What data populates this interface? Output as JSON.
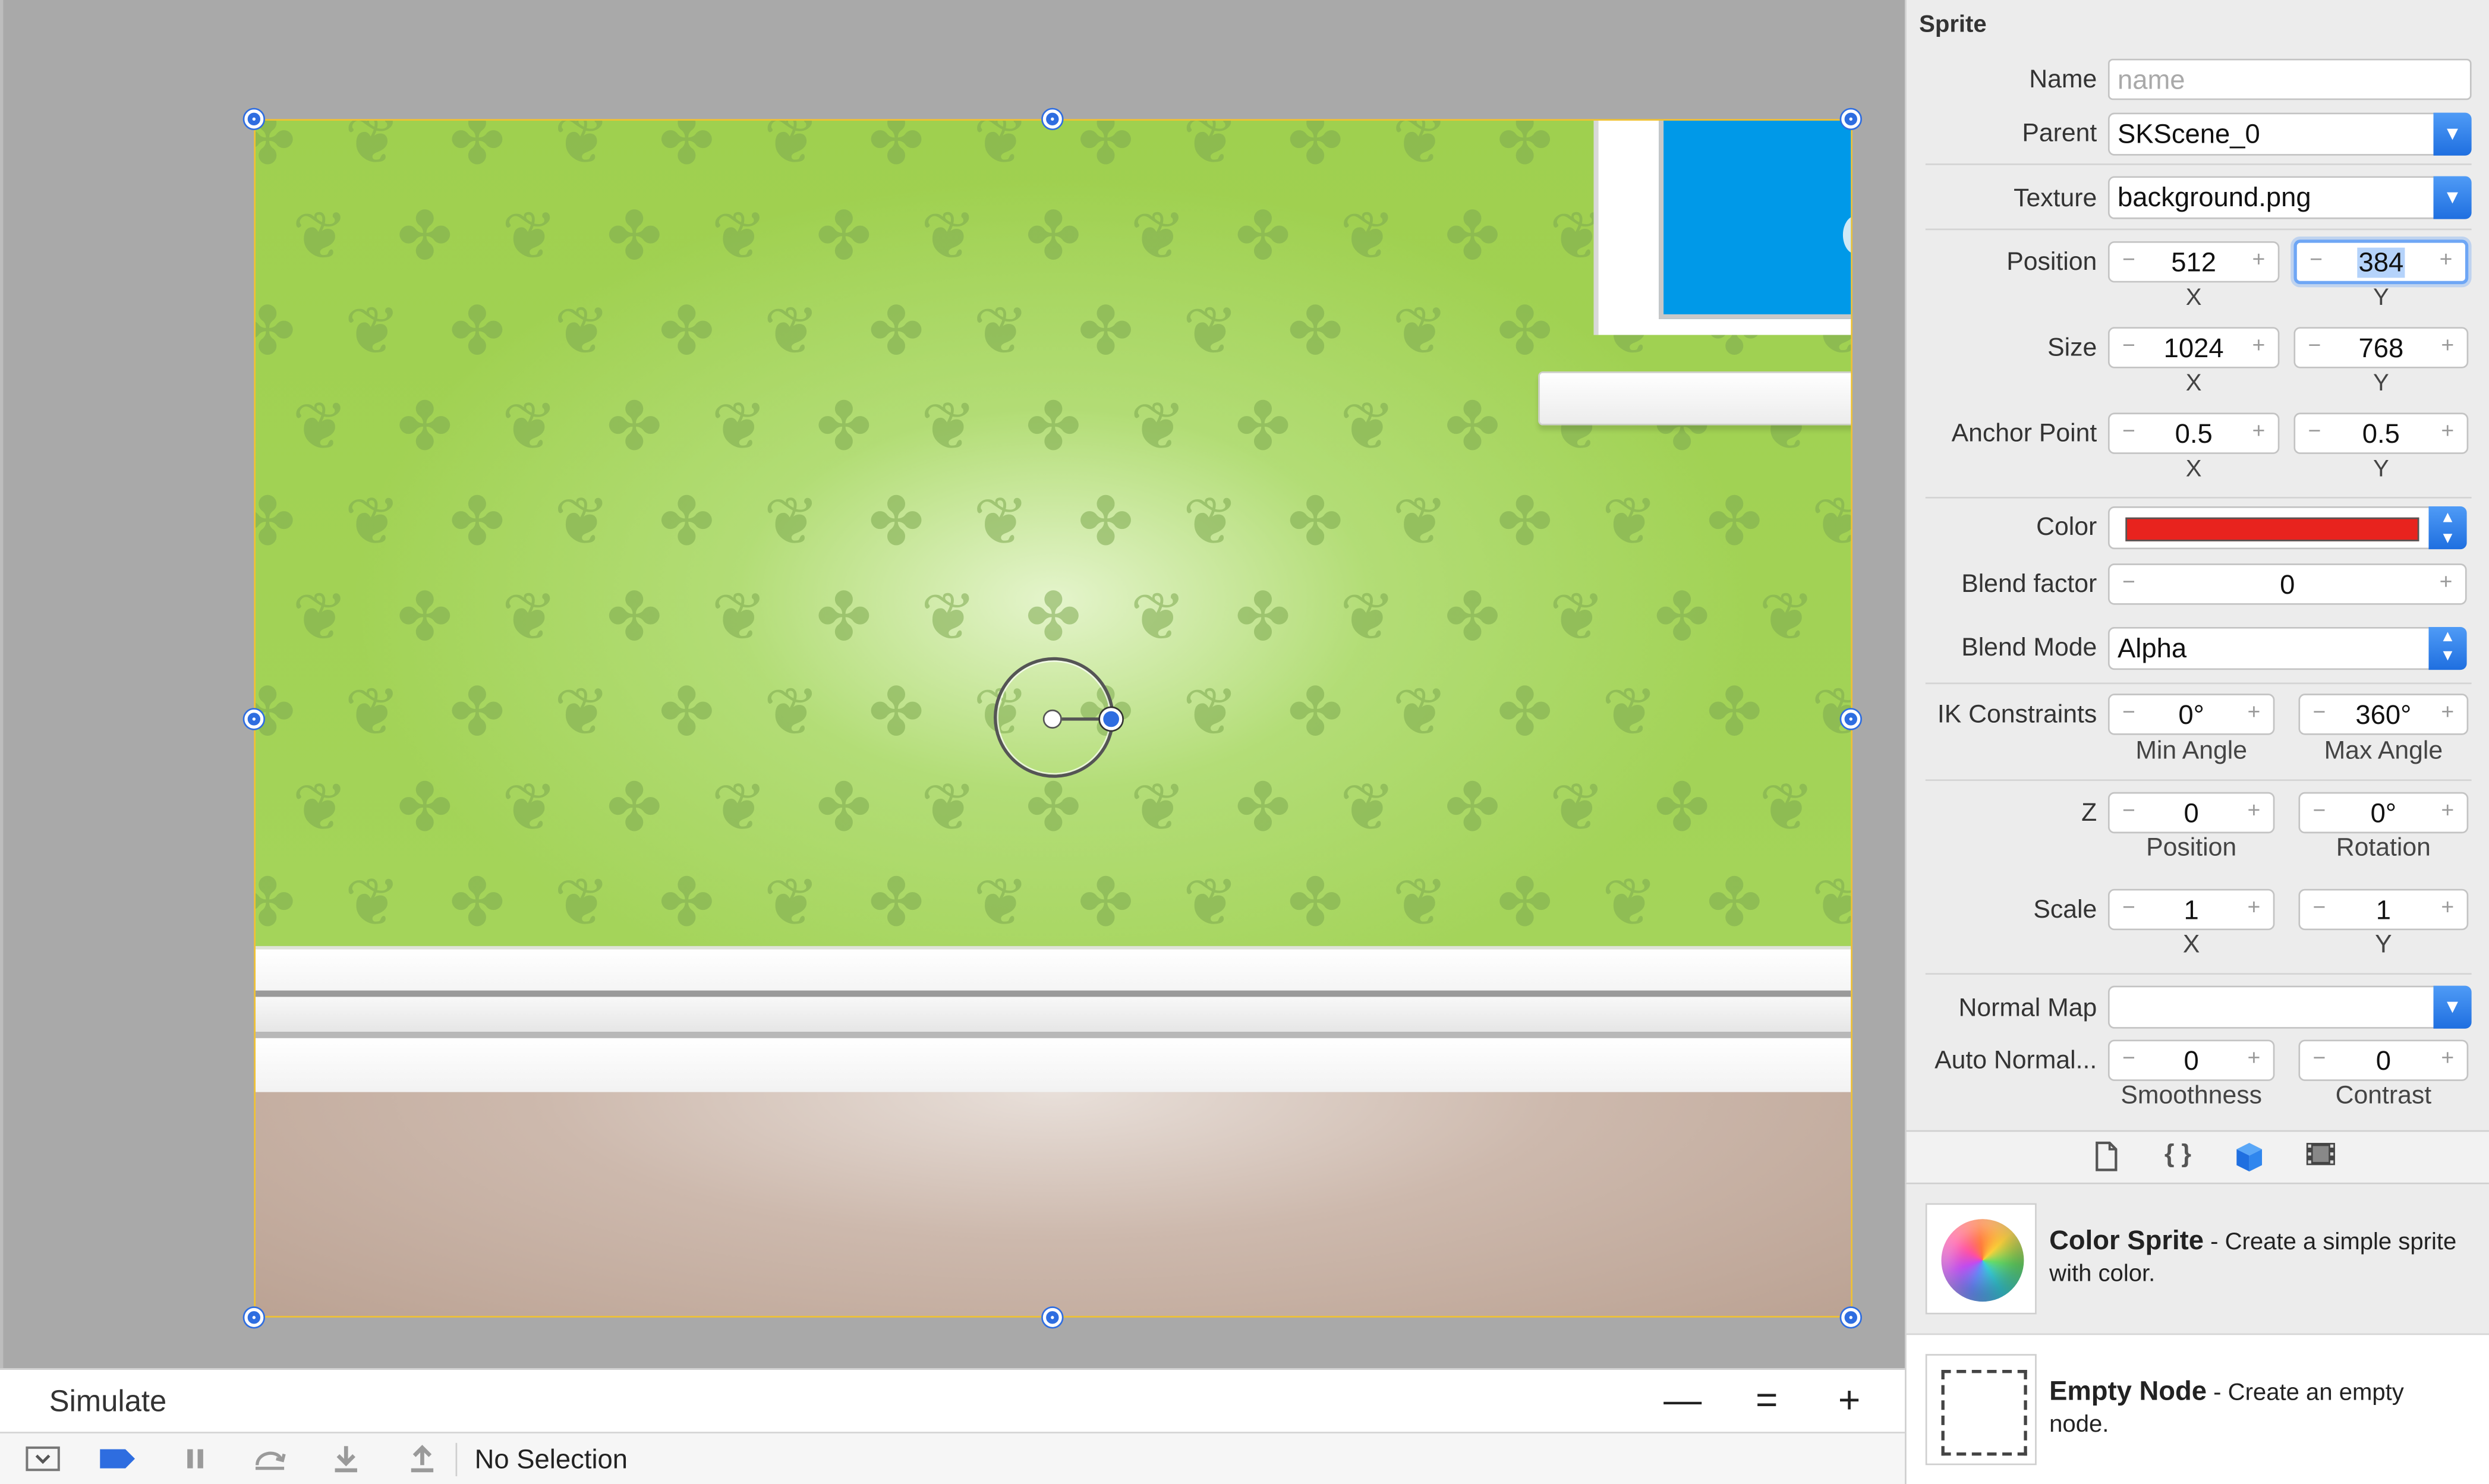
{
  "inspector": {
    "section_title": "Sprite",
    "name": {
      "label": "Name",
      "placeholder": "name"
    },
    "parent": {
      "label": "Parent",
      "value": "SKScene_0"
    },
    "texture": {
      "label": "Texture",
      "value": "background.png"
    },
    "position": {
      "label": "Position",
      "x": "512",
      "y": "384",
      "x_caption": "X",
      "y_caption": "Y"
    },
    "size": {
      "label": "Size",
      "x": "1024",
      "y": "768",
      "x_caption": "X",
      "y_caption": "Y"
    },
    "anchor_point": {
      "label": "Anchor Point",
      "x": "0.5",
      "y": "0.5",
      "x_caption": "X",
      "y_caption": "Y"
    },
    "color": {
      "label": "Color",
      "value": "#e8231e"
    },
    "blend_factor": {
      "label": "Blend factor",
      "value": "0"
    },
    "blend_mode": {
      "label": "Blend Mode",
      "value": "Alpha"
    },
    "ik_constraints": {
      "label": "IK Constraints",
      "min": "0°",
      "max": "360°",
      "min_caption": "Min Angle",
      "max_caption": "Max Angle"
    },
    "z": {
      "label": "Z",
      "position": "0",
      "rotation": "0°",
      "position_caption": "Position",
      "rotation_caption": "Rotation"
    },
    "scale": {
      "label": "Scale",
      "x": "1",
      "y": "1",
      "x_caption": "X",
      "y_caption": "Y"
    },
    "normal_map": {
      "label": "Normal Map",
      "value": ""
    },
    "auto_normal": {
      "label": "Auto Normal...",
      "smoothness": "0",
      "contrast": "0",
      "smoothness_caption": "Smoothness",
      "contrast_caption": "Contrast"
    }
  },
  "library": {
    "tabs": [
      {
        "icon": "file-icon"
      },
      {
        "icon": "braces-icon"
      },
      {
        "icon": "cube-icon"
      },
      {
        "icon": "film-icon"
      }
    ],
    "items": [
      {
        "title": "Color Sprite",
        "description": " - Create a simple sprite with color.",
        "icon": "color-sphere-icon"
      },
      {
        "title": "Empty Node",
        "description": " - Create an empty node.",
        "icon": "dashed-square-icon"
      }
    ]
  },
  "simulate_bar": {
    "label": "Simulate",
    "zoom_out": "—",
    "zoom_reset": "=",
    "zoom_in": "+"
  },
  "debug_bar": {
    "status": "No Selection"
  },
  "colors": {
    "accent": "#2e6de0",
    "selection_border": "#f2c230",
    "editor_background": "#a9a9a9",
    "wall": "#a4d45a",
    "window_sky": "#0099e8"
  }
}
